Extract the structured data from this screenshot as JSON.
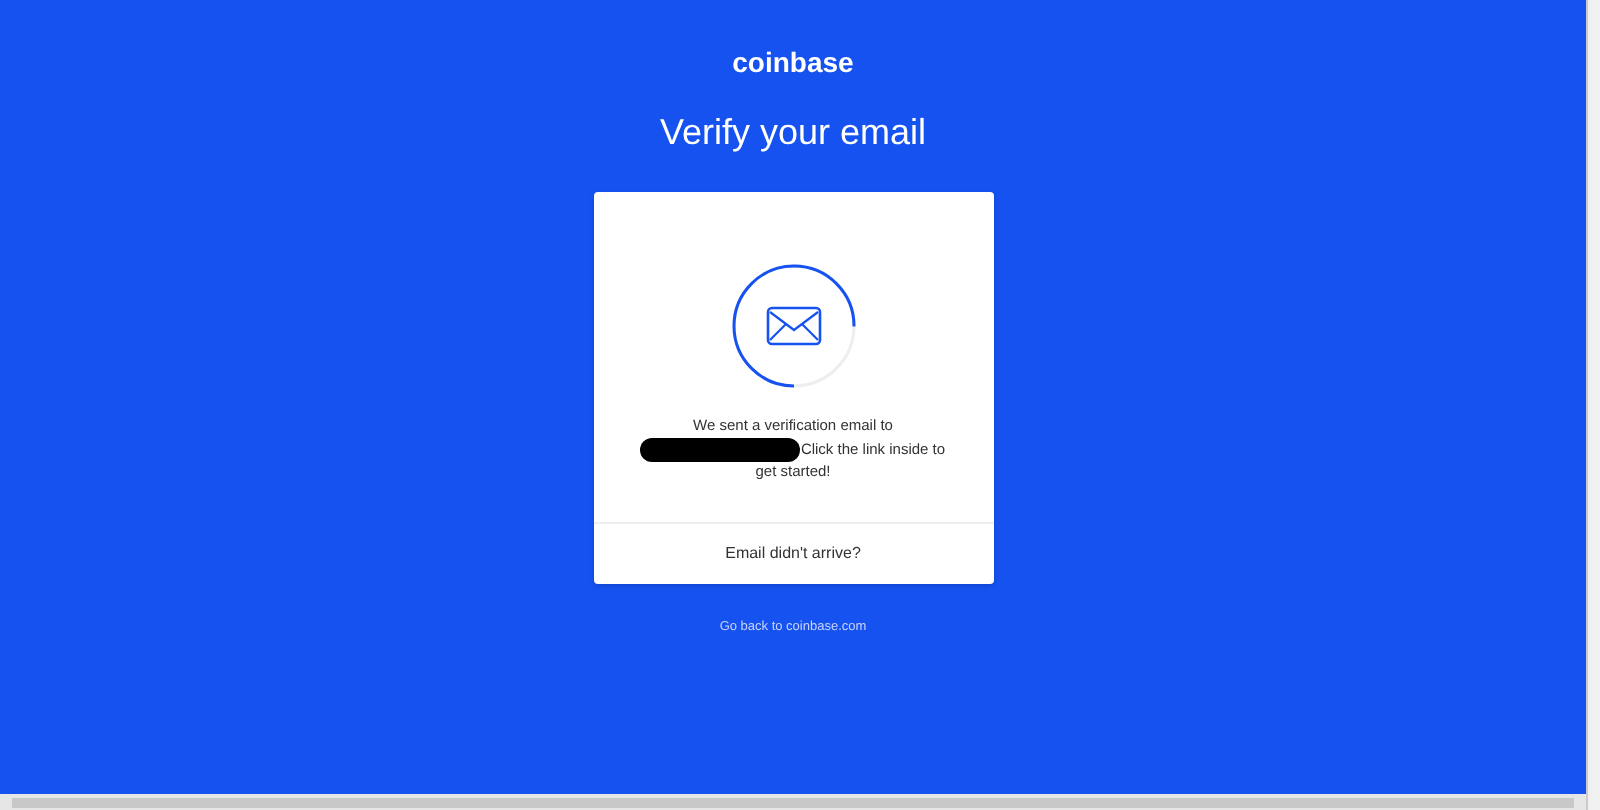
{
  "logo": "coinbase",
  "title": "Verify your email",
  "card": {
    "message_before": "We sent a verification email to",
    "message_after": "Click the link inside to",
    "message_end": "get started!",
    "footer_link": "Email didn't arrive?"
  },
  "back_link": "Go back to coinbase.com"
}
